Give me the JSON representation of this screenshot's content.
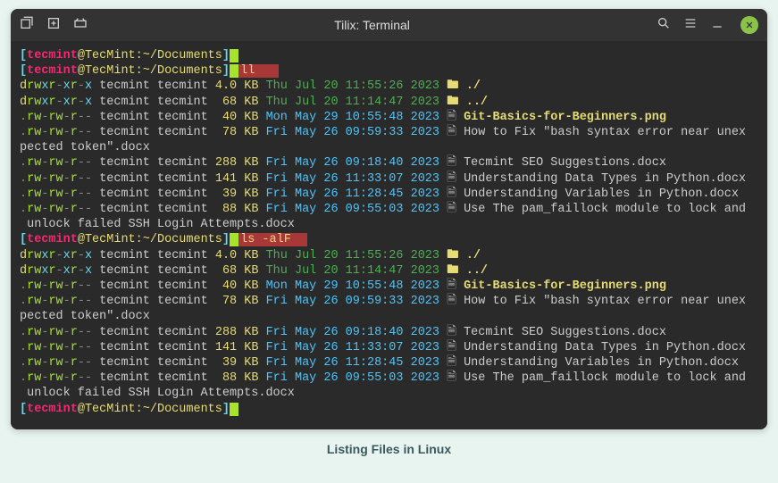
{
  "titlebar": {
    "title": "Tilix: Terminal"
  },
  "caption": "Listing Files in Linux",
  "prompt": {
    "open": "[",
    "user": "tecmint",
    "at": "@",
    "host": "TecMint",
    "sep": ":",
    "path": "~/Documents",
    "close": "]"
  },
  "commands": {
    "cmd1": "ll",
    "cmd2": "ls -alF"
  },
  "listing": {
    "rows": [
      {
        "perm": "drwxr-xr-x",
        "owner": "tecmint tecmint",
        "size": "4.0 KB",
        "date": "Thu Jul 20 11:55:26 2023",
        "dateColor": "green",
        "icon": "📁",
        "file": "./",
        "bold": true
      },
      {
        "perm": "drwxr-xr-x",
        "owner": "tecmint tecmint",
        "size": " 68 KB",
        "date": "Thu Jul 20 11:14:47 2023",
        "dateColor": "green",
        "icon": "📁",
        "file": "../",
        "bold": true
      },
      {
        "perm": ".rw-rw-r--",
        "owner": "tecmint tecmint",
        "size": " 40 KB",
        "date": "Mon May 29 10:55:48 2023",
        "dateColor": "blue",
        "icon": "🗎",
        "file": "Git-Basics-for-Beginners.png",
        "bold": true
      },
      {
        "perm": ".rw-rw-r--",
        "owner": "tecmint tecmint",
        "size": " 78 KB",
        "date": "Fri May 26 09:59:33 2023",
        "dateColor": "blue",
        "icon": "🗎",
        "file": "How to Fix \"bash syntax error near unex",
        "bold": false
      }
    ],
    "wrap1": "pected token\".docx",
    "rows2": [
      {
        "perm": ".rw-rw-r--",
        "owner": "tecmint tecmint",
        "size": "288 KB",
        "date": "Fri May 26 09:18:40 2023",
        "dateColor": "blue",
        "icon": "🗎",
        "file": "Tecmint SEO Suggestions.docx",
        "bold": false
      },
      {
        "perm": ".rw-rw-r--",
        "owner": "tecmint tecmint",
        "size": "141 KB",
        "date": "Fri May 26 11:33:07 2023",
        "dateColor": "blue",
        "icon": "🗎",
        "file": "Understanding Data Types in Python.docx",
        "bold": false
      },
      {
        "perm": ".rw-rw-r--",
        "owner": "tecmint tecmint",
        "size": " 39 KB",
        "date": "Fri May 26 11:28:45 2023",
        "dateColor": "blue",
        "icon": "🗎",
        "file": "Understanding Variables in Python.docx",
        "bold": false
      },
      {
        "perm": ".rw-rw-r--",
        "owner": "tecmint tecmint",
        "size": " 88 KB",
        "date": "Fri May 26 09:55:03 2023",
        "dateColor": "blue",
        "icon": "🗎",
        "file": "Use The pam_faillock module to lock and",
        "bold": false
      }
    ],
    "wrap2": " unlock failed SSH Login Attempts.docx"
  }
}
